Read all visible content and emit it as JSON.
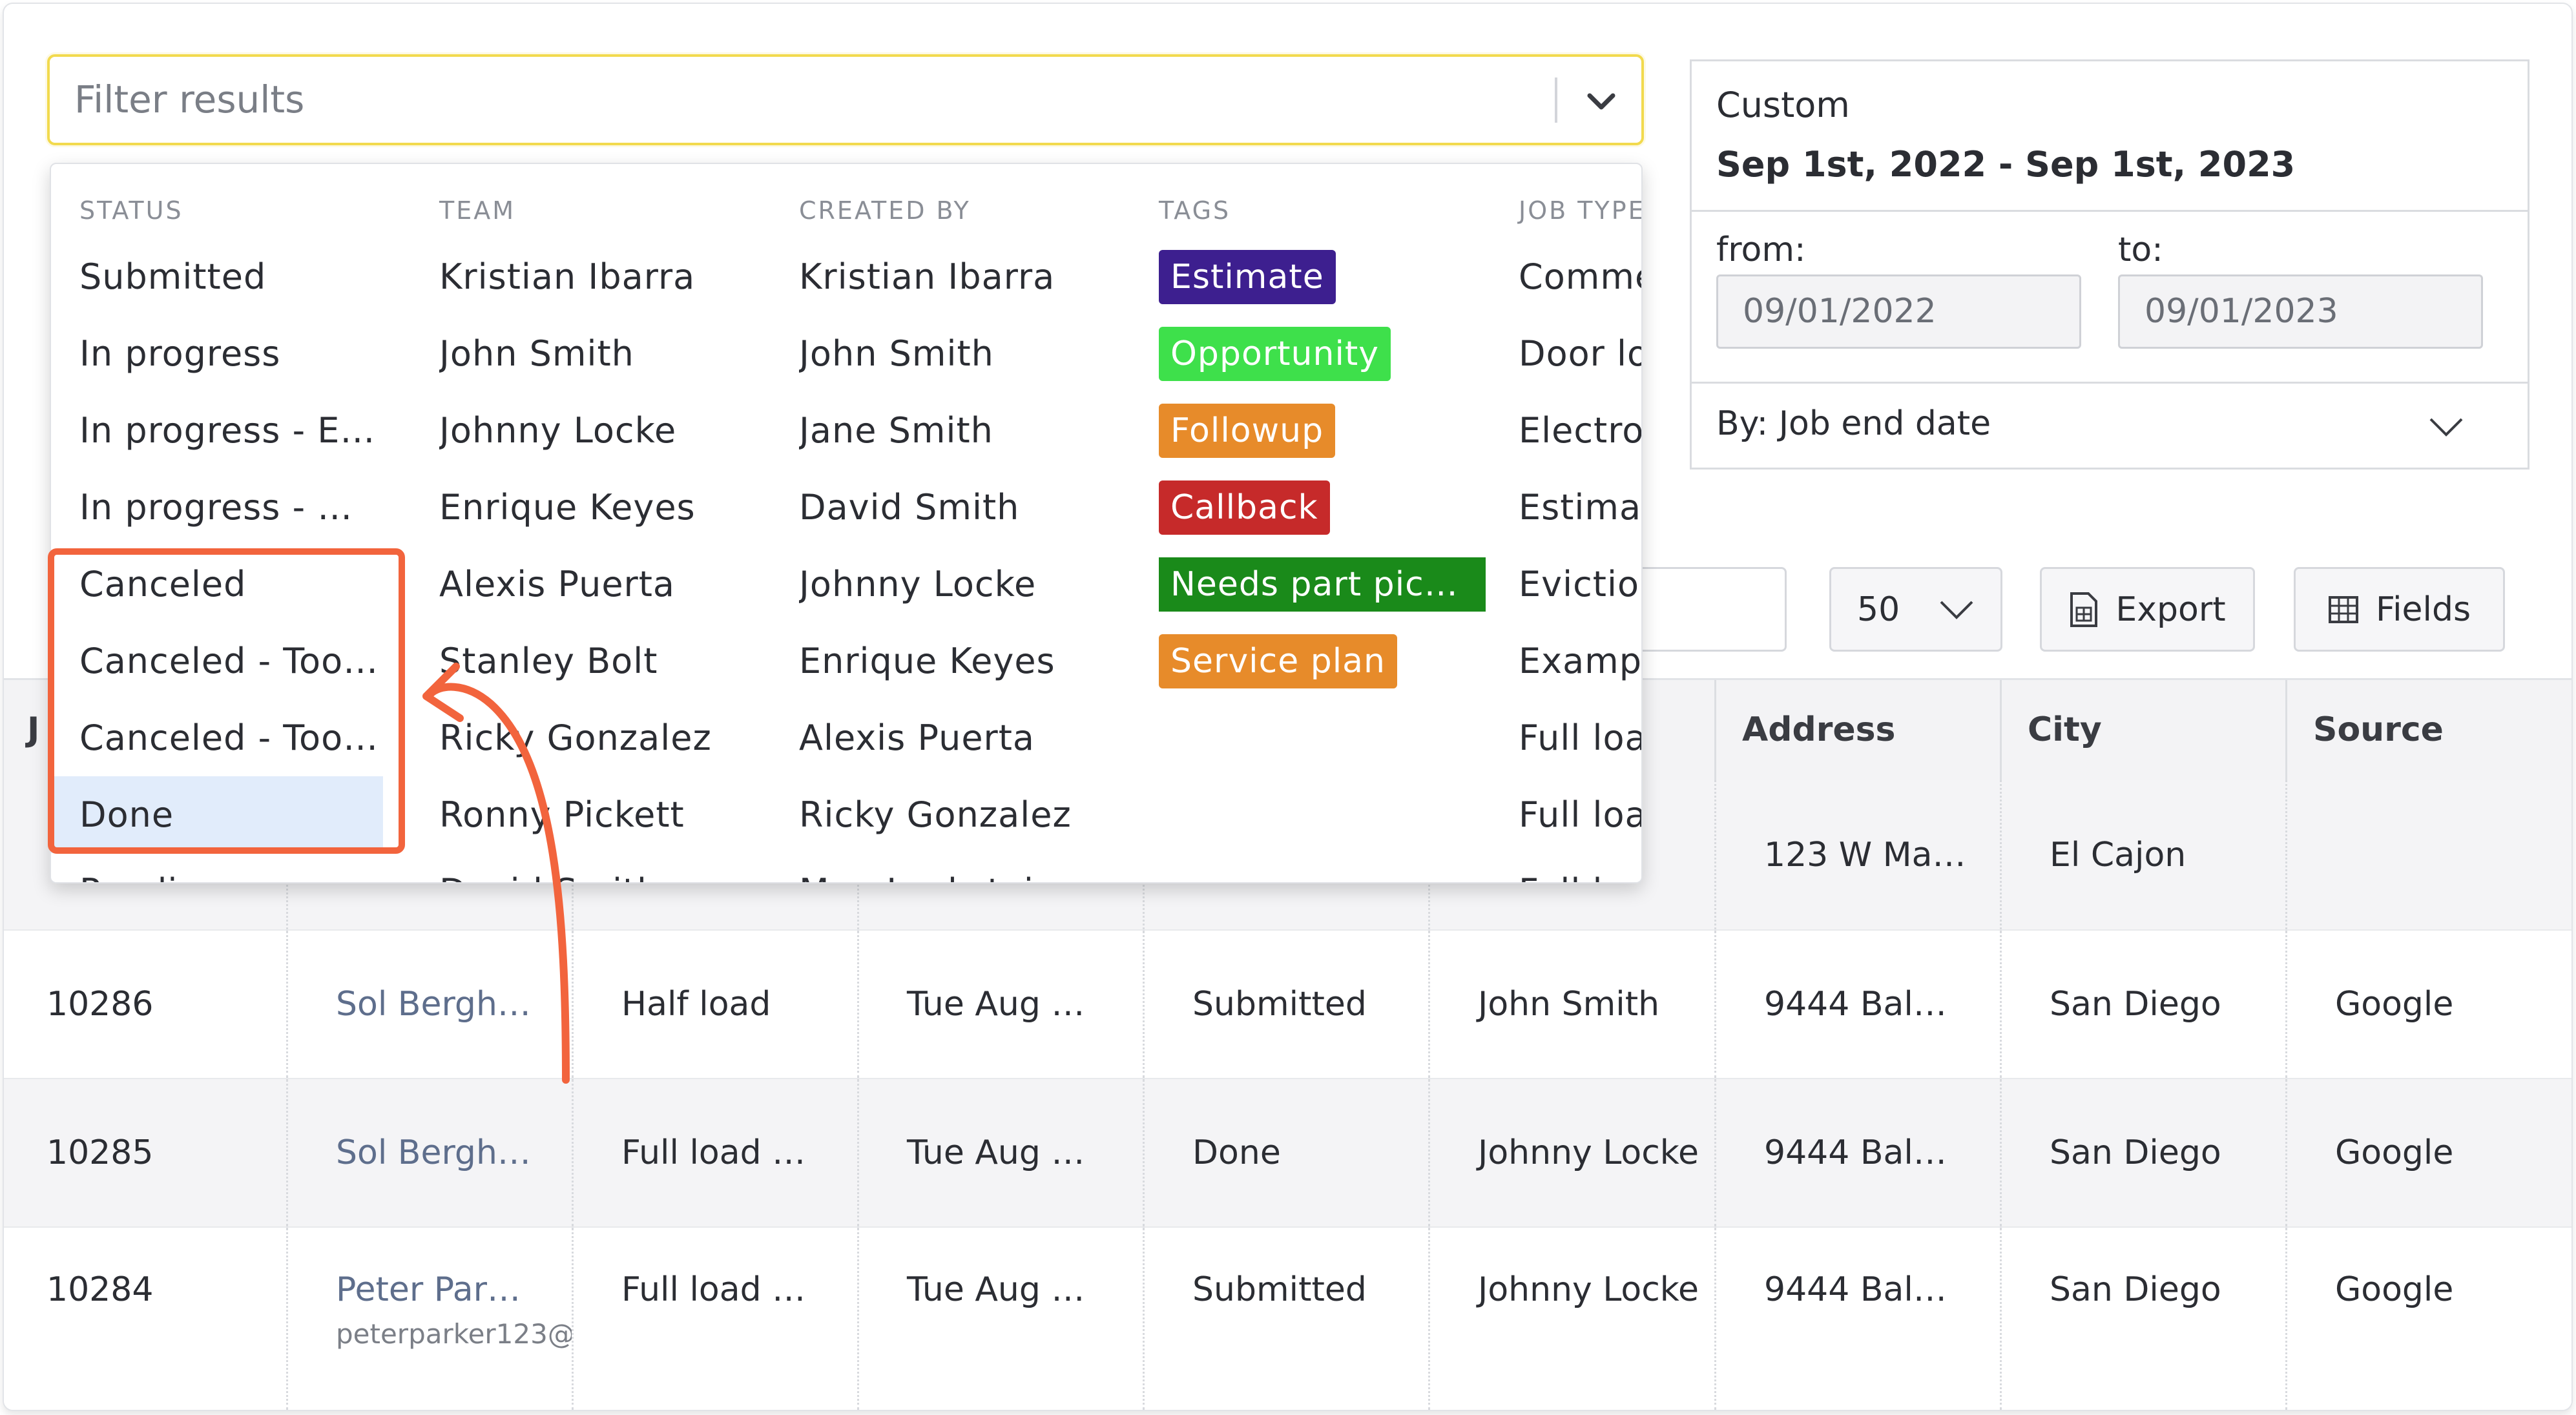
{
  "filter": {
    "placeholder": "Filter results"
  },
  "dropdown": {
    "columns": [
      {
        "heading": "STATUS",
        "items": [
          "Submitted",
          "In progress",
          "In progress - En…",
          "In progress - W…",
          "Canceled",
          "Canceled - Too…",
          "Canceled - Too…",
          "Done",
          "Pending"
        ],
        "selected": "Done"
      },
      {
        "heading": "TEAM",
        "items": [
          "Kristian Ibarra",
          "John Smith",
          "Johnny Locke",
          "Enrique Keyes",
          "Alexis Puerta",
          "Stanley Bolt",
          "Ricky Gonzalez",
          "Ronny Pickett",
          "David Smith"
        ]
      },
      {
        "heading": "CREATED BY",
        "items": [
          "Kristian Ibarra",
          "John Smith",
          "Jane Smith",
          "David Smith",
          "Johnny Locke",
          "Enrique Keyes",
          "Alexis Puerta",
          "Ricky Gonzalez",
          "Meg Lockstein"
        ]
      },
      {
        "heading": "TAGS",
        "tags": [
          {
            "label": "Estimate",
            "color": "#3d1f8f"
          },
          {
            "label": "Opportunity",
            "color": "#3ee04b"
          },
          {
            "label": "Followup",
            "color": "#e78b2a"
          },
          {
            "label": "Callback",
            "color": "#c62a2a"
          },
          {
            "label": "Needs part pic…",
            "color": "#1a8a1a"
          },
          {
            "label": "Service plan",
            "color": "#e78b2a"
          }
        ]
      },
      {
        "heading": "JOB TYPE",
        "items": [
          "Commercial",
          "Door local",
          "Electronics",
          "Estimate",
          "Eviction",
          "Example",
          "Full load",
          "Full load",
          "Full load"
        ]
      }
    ]
  },
  "date_panel": {
    "range_label": "Custom",
    "range_value": "Sep 1st, 2022 - Sep 1st, 2023",
    "from_label": "from:",
    "from_value": "09/01/2022",
    "to_label": "to:",
    "to_value": "09/01/2023",
    "by_label": "By: Job end date"
  },
  "toolbar": {
    "per_page": "50",
    "export_label": "Export",
    "fields_label": "Fields"
  },
  "table": {
    "headers": [
      "J",
      "Address",
      "City",
      "Source"
    ],
    "rows": [
      {
        "id": "",
        "customer": "",
        "customer_email": "",
        "job_type": "",
        "date": "",
        "status": "",
        "team": "",
        "address": "123 W Ma…",
        "city": "El Cajon",
        "source": ""
      },
      {
        "id": "10286",
        "customer": "Sol Bergh…",
        "customer_email": "",
        "job_type": "Half load",
        "date": "Tue Aug …",
        "status": "Submitted",
        "team": "John Smith",
        "address": "9444 Bal…",
        "city": "San Diego",
        "source": "Google"
      },
      {
        "id": "10285",
        "customer": "Sol Bergh…",
        "customer_email": "",
        "job_type": "Full load …",
        "date": "Tue Aug …",
        "status": "Done",
        "team": "Johnny Locke",
        "address": "9444 Bal…",
        "city": "San Diego",
        "source": "Google"
      },
      {
        "id": "10284",
        "customer": "Peter Par…",
        "customer_email": "peterparker123@",
        "job_type": "Full load …",
        "date": "Tue Aug …",
        "status": "Submitted",
        "team": "Johnny Locke",
        "address": "9444 Bal…",
        "city": "San Diego",
        "source": "Google"
      }
    ]
  },
  "colors": {
    "highlight": "#f2643d",
    "filter_border": "#f2da4e",
    "selected_bg": "#e1ecfb",
    "link": "#5e6e8c"
  }
}
